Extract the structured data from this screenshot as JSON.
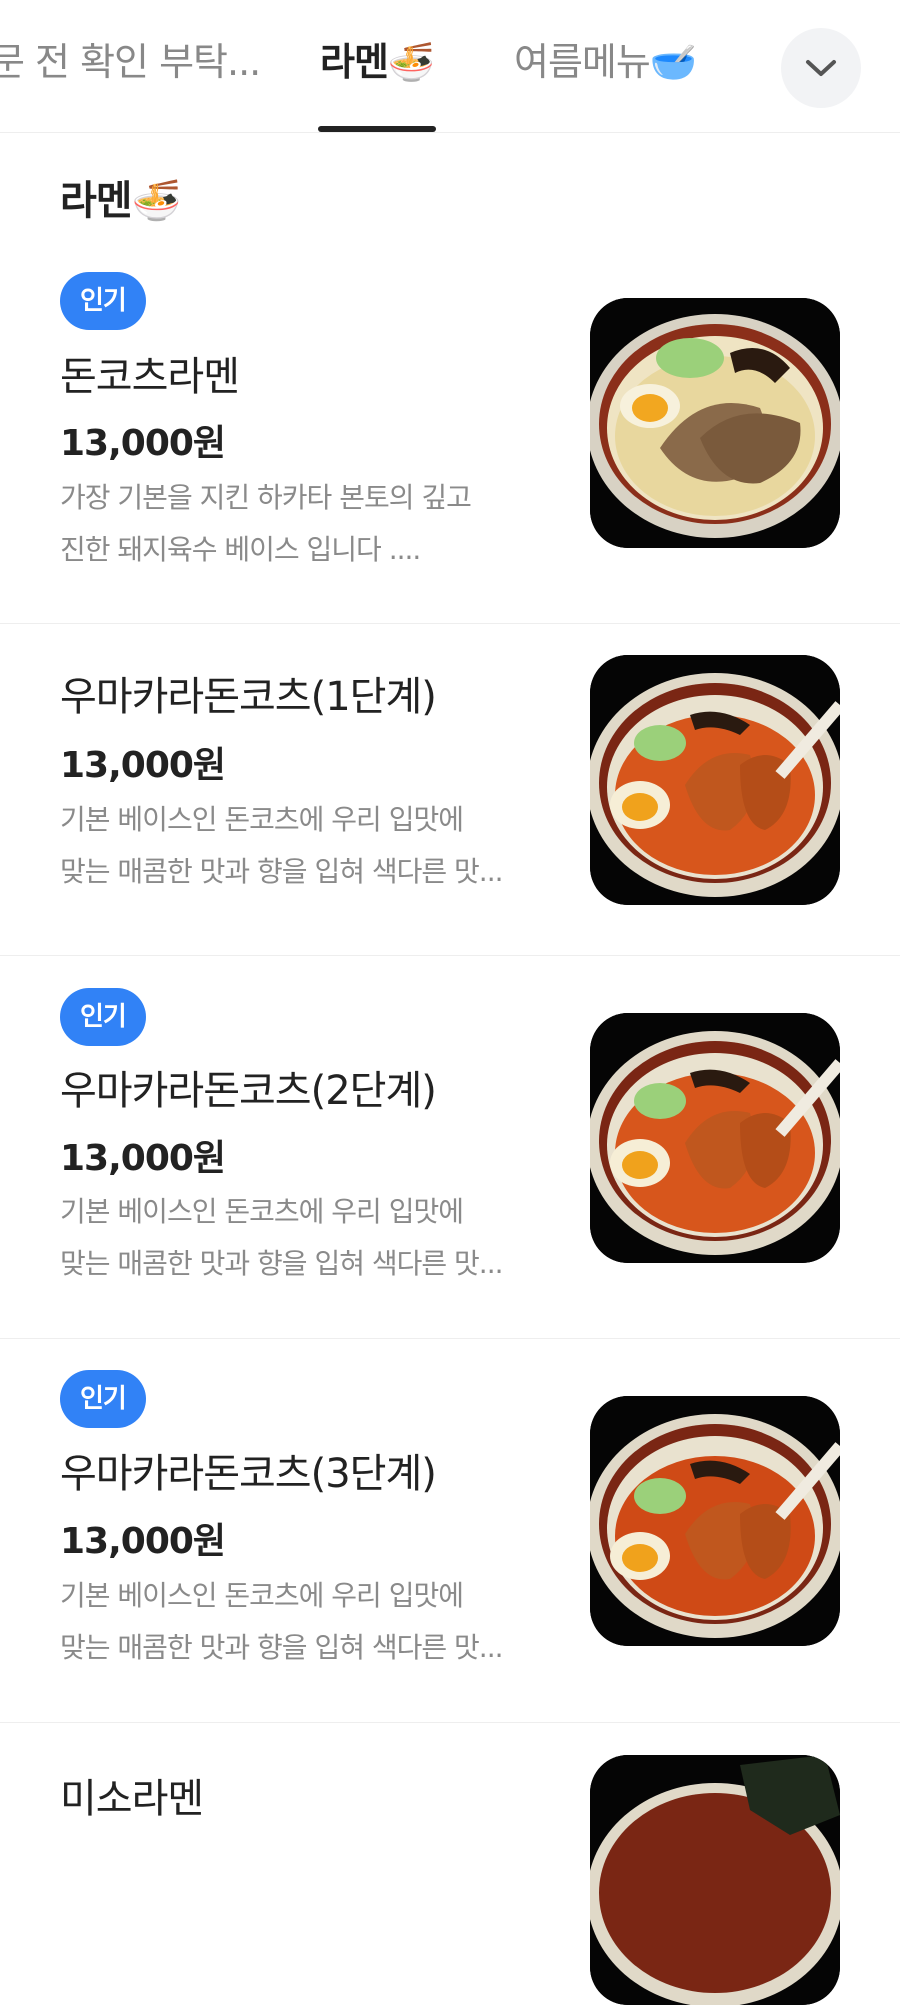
{
  "tabs": [
    {
      "label": "문 전 확인 부탁...",
      "active": false
    },
    {
      "label": "라멘🍜",
      "active": true
    },
    {
      "label": "여름메뉴🥣",
      "active": false
    }
  ],
  "icons": {
    "expand": "chevron-down-icon"
  },
  "section": {
    "title": "라멘🍜"
  },
  "items": [
    {
      "badge": "인기",
      "name": "돈코츠라멘",
      "price": "13,000원",
      "desc_lines": [
        "가장 기본을 지킨 하카타 본토의 깊고",
        "진한 돼지육수 베이스 입니다 ...."
      ],
      "image": "tonkotsu-ramen-photo"
    },
    {
      "badge": "",
      "name": "우마카라돈코츠(1단계)",
      "price": "13,000원",
      "desc_lines": [
        "기본 베이스인 돈코츠에 우리 입맛에",
        "맞는 매콤한 맛과 향을 입혀 색다른 맛..."
      ],
      "image": "spicy-tonkotsu-ramen-photo"
    },
    {
      "badge": "인기",
      "name": "우마카라돈코츠(2단계)",
      "price": "13,000원",
      "desc_lines": [
        "기본 베이스인 돈코츠에 우리 입맛에",
        "맞는 매콤한 맛과 향을 입혀 색다른 맛..."
      ],
      "image": "spicy-tonkotsu-ramen-photo"
    },
    {
      "badge": "인기",
      "name": "우마카라돈코츠(3단계)",
      "price": "13,000원",
      "desc_lines": [
        "기본 베이스인 돈코츠에 우리 입맛에",
        "맞는 매콤한 맛과 향을 입혀 색다른 맛..."
      ],
      "image": "spicy-tonkotsu-ramen-photo"
    },
    {
      "badge": "",
      "name": "미소라멘",
      "price": "",
      "desc_lines": [],
      "image": "miso-ramen-photo"
    }
  ],
  "colors": {
    "badge": "#3182f6",
    "text": "#222222",
    "muted": "#8a8a8a",
    "divider": "#eeeeee"
  }
}
